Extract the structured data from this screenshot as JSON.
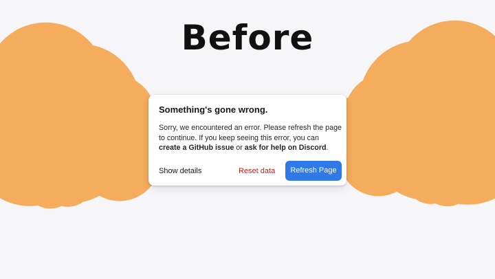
{
  "hero": {
    "title": "Before"
  },
  "dialog": {
    "title": "Something's gone wrong.",
    "body_text": "Sorry, we encountered an error. Please refresh the page to continue. If you keep seeing this error, you can ",
    "link_github": "create a GitHub issue",
    "body_or": " or ",
    "link_discord": "ask for help on Discord",
    "body_end": ".",
    "show_details_label": "Show details",
    "reset_data_label": "Reset data",
    "refresh_label": "Refresh Page"
  },
  "colors": {
    "background": "#f6f6f9",
    "star_fill": "#fbeadd",
    "star_stroke": "#f5ad5d",
    "danger": "#d11a1a",
    "primary": "#2f7ae8"
  },
  "icons": [
    "star-icon"
  ]
}
